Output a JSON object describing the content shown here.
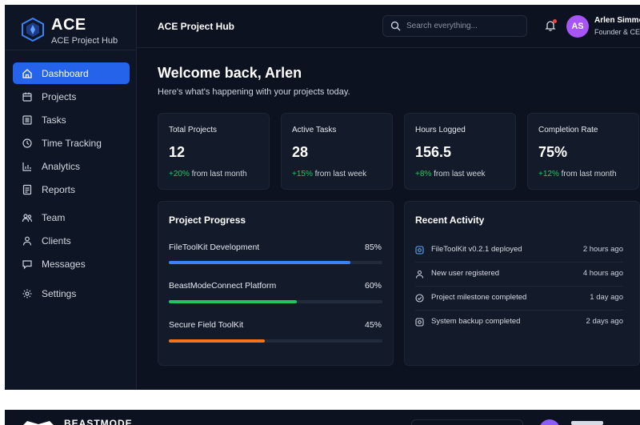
{
  "brand": {
    "name": "ACE",
    "subtitle": "ACE Project Hub"
  },
  "sidebar": {
    "items": [
      {
        "label": "Dashboard",
        "icon": "home-icon",
        "active": true
      },
      {
        "label": "Projects",
        "icon": "calendar-icon"
      },
      {
        "label": "Tasks",
        "icon": "list-icon"
      },
      {
        "label": "Time Tracking",
        "icon": "clock-icon"
      },
      {
        "label": "Analytics",
        "icon": "bar-chart-icon"
      },
      {
        "label": "Reports",
        "icon": "reports-icon"
      },
      {
        "label": "Team",
        "icon": "team-icon"
      },
      {
        "label": "Clients",
        "icon": "user-icon"
      },
      {
        "label": "Messages",
        "icon": "message-icon"
      },
      {
        "label": "Settings",
        "icon": "gear-icon"
      }
    ]
  },
  "header": {
    "title": "ACE Project Hub",
    "search_placeholder": "Search everything...",
    "user": {
      "initials": "AS",
      "name": "Arlen Simmons",
      "role": "Founder & CEO"
    }
  },
  "main": {
    "welcome": "Welcome back, Arlen",
    "subtitle": "Here's what's happening with your projects today.",
    "stats": [
      {
        "label": "Total Projects",
        "value": "12",
        "change": "+20%",
        "period": "from last month"
      },
      {
        "label": "Active Tasks",
        "value": "28",
        "change": "+15%",
        "period": "from last week"
      },
      {
        "label": "Hours Logged",
        "value": "156.5",
        "change": "+8%",
        "period": "from last week"
      },
      {
        "label": "Completion Rate",
        "value": "75%",
        "change": "+12%",
        "period": "from last month"
      }
    ],
    "progress": {
      "title": "Project Progress",
      "projects": [
        {
          "name": "FileToolKit Development",
          "percent_label": "85%",
          "percent": 0.85,
          "color": "#3b82f6"
        },
        {
          "name": "BeastModeConnect Platform",
          "percent_label": "60%",
          "percent": 0.6,
          "color": "#22c55e"
        },
        {
          "name": "Secure Field ToolKit",
          "percent_label": "45%",
          "percent": 0.45,
          "color": "#f97316"
        }
      ]
    },
    "activity": {
      "title": "Recent Activity",
      "items": [
        {
          "text": "FileToolKit v0.2.1 deployed",
          "time": "2 hours ago",
          "icon": "deploy-icon"
        },
        {
          "text": "New user registered",
          "time": "4 hours ago",
          "icon": "user-icon"
        },
        {
          "text": "Project milestone completed",
          "time": "1 day ago",
          "icon": "check-circle-icon"
        },
        {
          "text": "System backup completed",
          "time": "2 days ago",
          "icon": "backup-icon"
        }
      ]
    }
  },
  "second_window": {
    "brand_text": "BEASTMODE"
  },
  "colors": {
    "accent": "#2563eb",
    "positive": "#22c55e",
    "avatar": "#a855f7",
    "background": "#0c1220"
  }
}
